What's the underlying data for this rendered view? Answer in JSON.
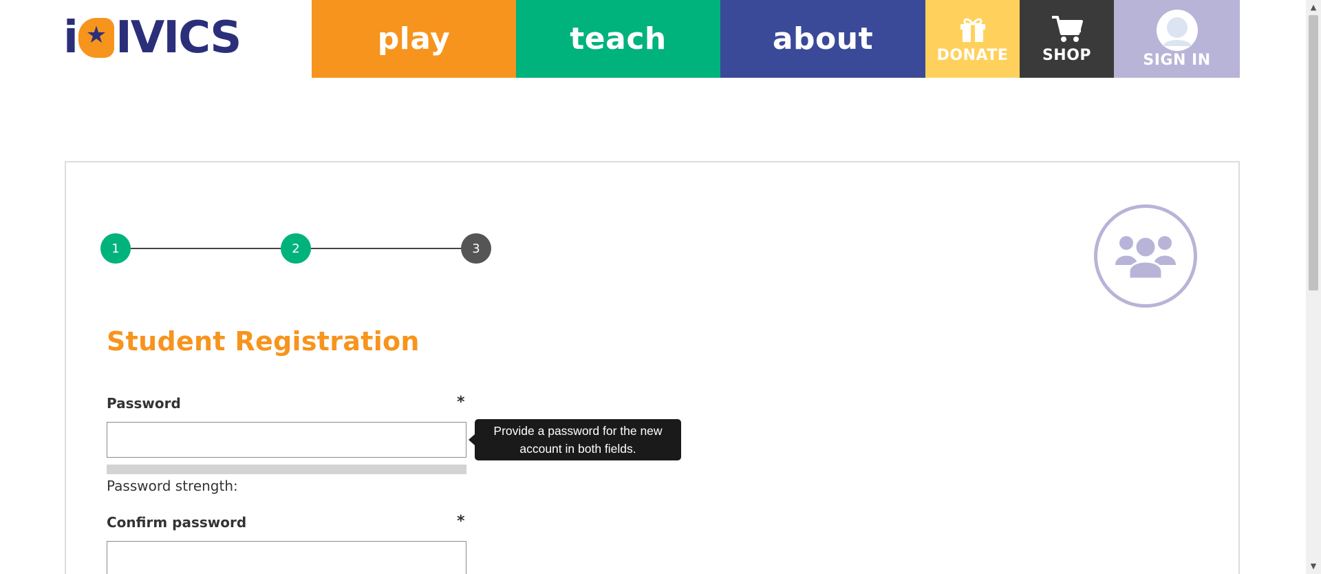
{
  "header": {
    "logo_text_a": "i",
    "logo_text_b": "IVICS",
    "nav": {
      "play": "play",
      "teach": "teach",
      "about": "about",
      "donate": "DONATE",
      "shop": "SHOP",
      "sign_in": "SIGN IN"
    },
    "icons": {
      "donate": "gift-icon",
      "shop": "cart-icon",
      "sign_in": "avatar-icon",
      "logo_star": "star-icon"
    }
  },
  "stepper": {
    "steps": [
      "1",
      "2",
      "3"
    ],
    "current_step": 3
  },
  "form": {
    "title": "Student Registration",
    "password": {
      "label": "Password",
      "required_mark": "*",
      "value": "",
      "strength_text": "Password strength:",
      "strength_level": 0
    },
    "tooltip": "Provide a password for the new account in both fields.",
    "confirm_password": {
      "label": "Confirm password",
      "required_mark": "*",
      "value": ""
    }
  },
  "colors": {
    "orange": "#f7941d",
    "green": "#00b27c",
    "blue": "#3a4a98",
    "yellow": "#ffd15c",
    "dark": "#3a3a3a",
    "lavender": "#b8b4d8",
    "navy": "#2b2f7a"
  }
}
